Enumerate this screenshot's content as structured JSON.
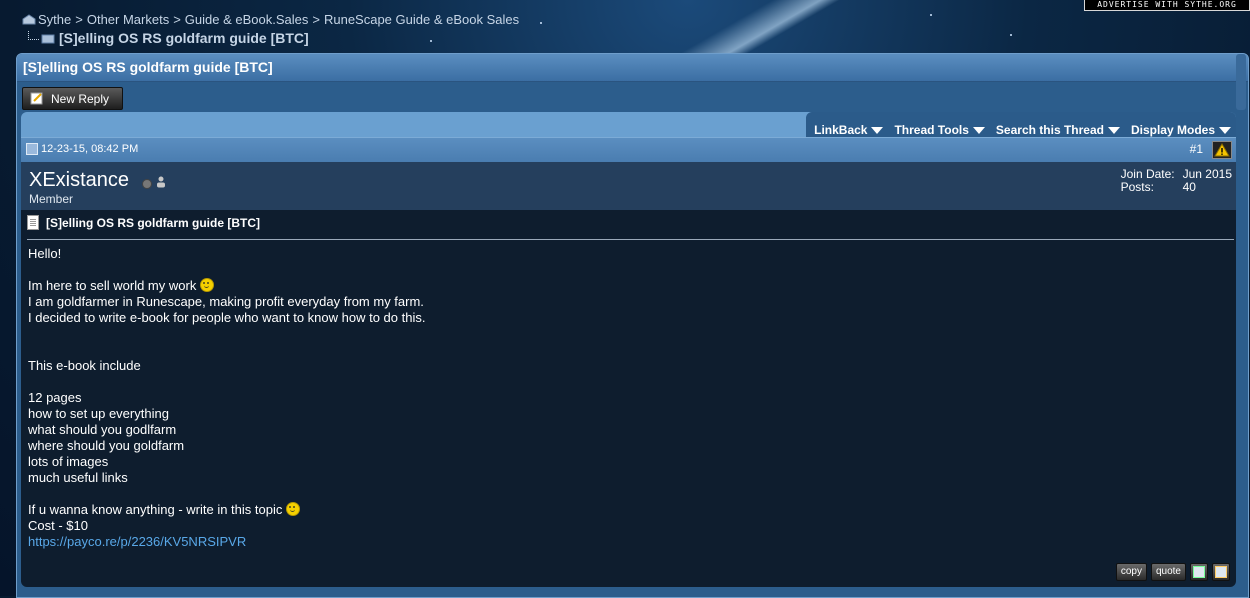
{
  "advertise": {
    "text": "ADVERTISE WITH SYTHE.ORG"
  },
  "breadcrumb": {
    "items": [
      "Sythe",
      "Other Markets",
      "Guide & eBook.Sales",
      "RuneScape Guide & eBook Sales"
    ],
    "separator": ">",
    "current": "[S]elling OS RS goldfarm guide [BTC]"
  },
  "thread": {
    "title": "[S]elling OS RS goldfarm guide [BTC]",
    "new_reply_label": "New Reply",
    "tools": [
      "LinkBack",
      "Thread Tools",
      "Search this Thread",
      "Display Modes"
    ]
  },
  "post": {
    "date": "12-23-15, 08:42 PM",
    "number": "#1",
    "username": "XExistance",
    "user_title": "Member",
    "join_date_label": "Join Date:",
    "join_date": "Jun 2015",
    "posts_label": "Posts:",
    "posts": "40",
    "title": "[S]elling OS RS goldfarm guide [BTC]",
    "lines": {
      "l1": "Hello!",
      "l2": "Im here to sell world my work",
      "l3": "I am goldfarmer in Runescape, making profit everyday from my farm.",
      "l4": "I decided to write e-book for people who want to know how to do this.",
      "l5": "This e-book include",
      "l6": "12 pages",
      "l7": "how to set up everything",
      "l8": "what should you godlfarm",
      "l9": "where should you goldfarm",
      "l10": "lots of images",
      "l11": "much useful links",
      "l12": "If u wanna know anything - write in this topic",
      "l13": "Cost - $10",
      "link": "https://payco.re/p/2236/KV5NRSIPVR"
    },
    "actions": {
      "copy": "copy",
      "quote": "quote"
    }
  },
  "colors": {
    "link": "#59a8e8",
    "header": "#3b6ea3",
    "body_bg": "#0e1d2e"
  },
  "icons": [
    "home-icon",
    "folder-icon",
    "new-reply-icon",
    "caret-down-icon",
    "post-icon",
    "report-icon",
    "offline-status-icon",
    "user-icon",
    "document-icon",
    "smiley-icon",
    "multiquote-icon",
    "edit-icon"
  ]
}
